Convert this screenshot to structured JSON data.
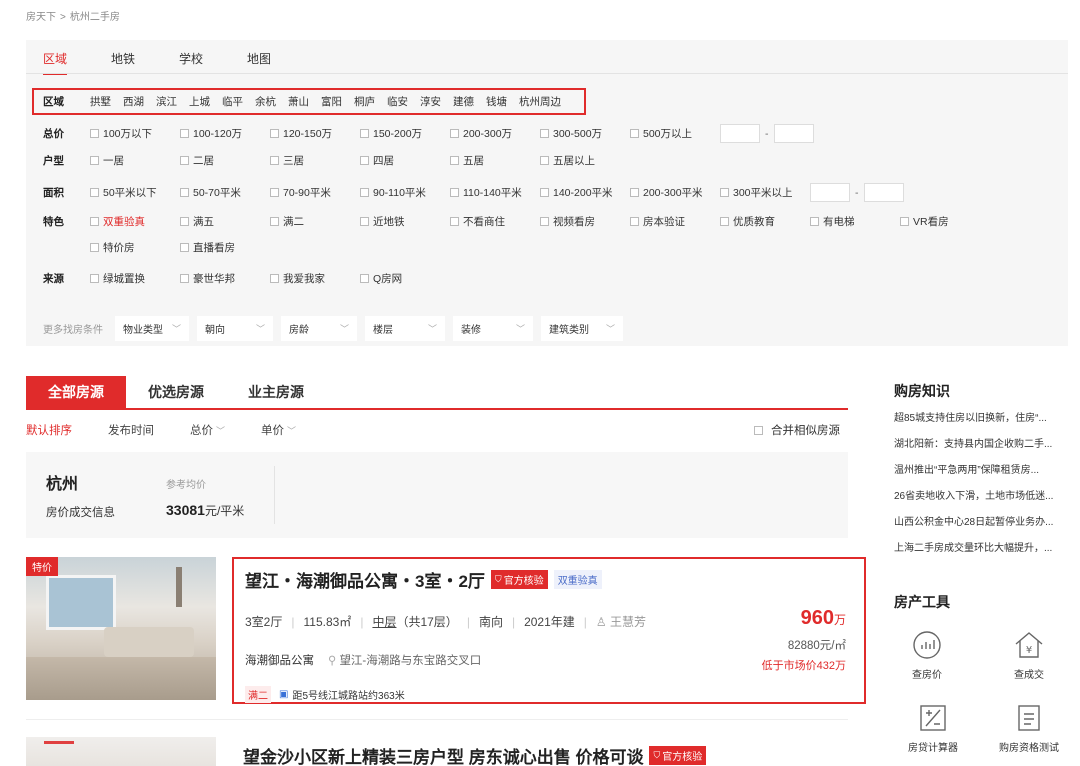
{
  "breadcrumb": [
    "房天下",
    ">",
    "杭州二手房"
  ],
  "filter_tabs": [
    "区域",
    "地铁",
    "学校",
    "地图"
  ],
  "area": {
    "label": "区域",
    "items": [
      "拱墅",
      "西湖",
      "滨江",
      "上城",
      "临平",
      "余杭",
      "萧山",
      "富阳",
      "桐庐",
      "临安",
      "淳安",
      "建德",
      "钱塘",
      "杭州周边"
    ]
  },
  "price": {
    "label": "总价",
    "options": [
      "100万以下",
      "100-120万",
      "120-150万",
      "150-200万",
      "200-300万",
      "300-500万",
      "500万以上"
    ],
    "dash": "-"
  },
  "layout": {
    "label": "户型",
    "options": [
      "一居",
      "二居",
      "三居",
      "四居",
      "五居",
      "五居以上"
    ]
  },
  "size": {
    "label": "面积",
    "options": [
      "50平米以下",
      "50-70平米",
      "70-90平米",
      "90-110平米",
      "110-140平米",
      "140-200平米",
      "200-300平米",
      "300平米以上"
    ],
    "dash": "-"
  },
  "feature": {
    "label": "特色",
    "options": [
      "双重验真",
      "满五",
      "满二",
      "近地铁",
      "不看商住",
      "视频看房",
      "房本验证",
      "优质教育",
      "有电梯",
      "VR看房",
      "特价房",
      "直播看房"
    ]
  },
  "source": {
    "label": "来源",
    "options": [
      "绿城置换",
      "豪世华邦",
      "我爱我家",
      "Q房网"
    ]
  },
  "more": {
    "label": "更多找房条件",
    "dropdowns": [
      "物业类型",
      "朝向",
      "房龄",
      "楼层",
      "装修",
      "建筑类别"
    ]
  },
  "list_tabs": [
    "全部房源",
    "优选房源",
    "业主房源"
  ],
  "sorts": [
    "默认排序",
    "发布时间",
    "总价",
    "单价"
  ],
  "merge_label": "合并相似房源",
  "info": {
    "city": "杭州",
    "deal_info": "房价成交信息",
    "ref_label": "参考均价",
    "ref_value": "33081",
    "ref_unit": "元/平米"
  },
  "listing1": {
    "tag": "特价",
    "title": "望江・海潮御品公寓・3室・2厅",
    "badge_official": "官方核验",
    "badge_verify": "双重验真",
    "rooms": "3室2厅",
    "area": "115.83㎡",
    "floor": "中层",
    "floor_total": "（共17层）",
    "facing": "南向",
    "year": "2021年建",
    "agent": "王慧芳",
    "community": "海潮御品公寓",
    "address": "望江-海潮路与东宝路交叉口",
    "tag_full": "满二",
    "subway": "距5号线江城路站约363米",
    "price": "960",
    "price_unit": "万",
    "unit_price": "82880元/㎡",
    "below_market": "低于市场价432万"
  },
  "listing2": {
    "title": "望金沙小区新上精装三房户型 房东诚心出售 价格可谈",
    "badge_official": "官方核验"
  },
  "sidebar": {
    "knowledge_title": "购房知识",
    "news": [
      "超85城支持住房以旧换新，住房“...",
      "湖北阳新：支持县内国企收购二手...",
      "温州推出“平急两用”保障租赁房...",
      "26省卖地收入下滑，土地市场低迷...",
      "山西公积金中心28日起暂停业务办...",
      "上海二手房成交量环比大幅提升，..."
    ],
    "tools_title": "房产工具",
    "tools": [
      "查房价",
      "查成交",
      "房贷计算器",
      "购房资格测试"
    ]
  },
  "colors": {
    "accent": "#e02b2b",
    "link_blue": "#4a6cc8"
  }
}
